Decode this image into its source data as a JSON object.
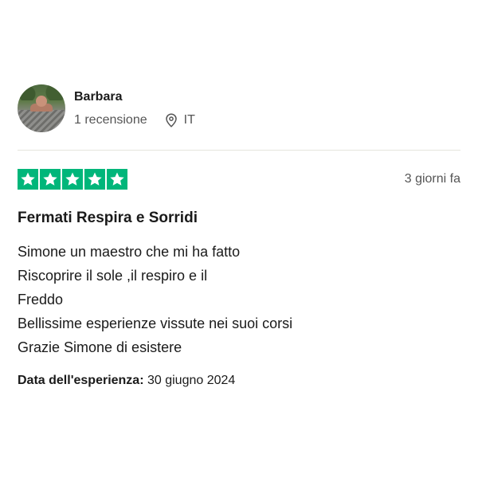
{
  "reviewer": {
    "name": "Barbara",
    "reviews_count": "1 recensione",
    "country": "IT"
  },
  "review": {
    "rating": 5,
    "rating_max": 5,
    "star_color": "#00b67a",
    "posted": "3 giorni fa",
    "title": "Fermati Respira e Sorridi",
    "body_lines": [
      "Simone un maestro che mi ha fatto",
      "Riscoprire il sole ,il respiro e il",
      "Freddo",
      "Bellissime esperienze vissute nei suoi corsi",
      "Grazie Simone di esistere"
    ],
    "experience_label": "Data dell'esperienza:",
    "experience_date": "30 giugno 2024"
  },
  "icons": {
    "avatar": "user-avatar-photo",
    "location": "location-pin-icon",
    "star": "star-icon"
  }
}
